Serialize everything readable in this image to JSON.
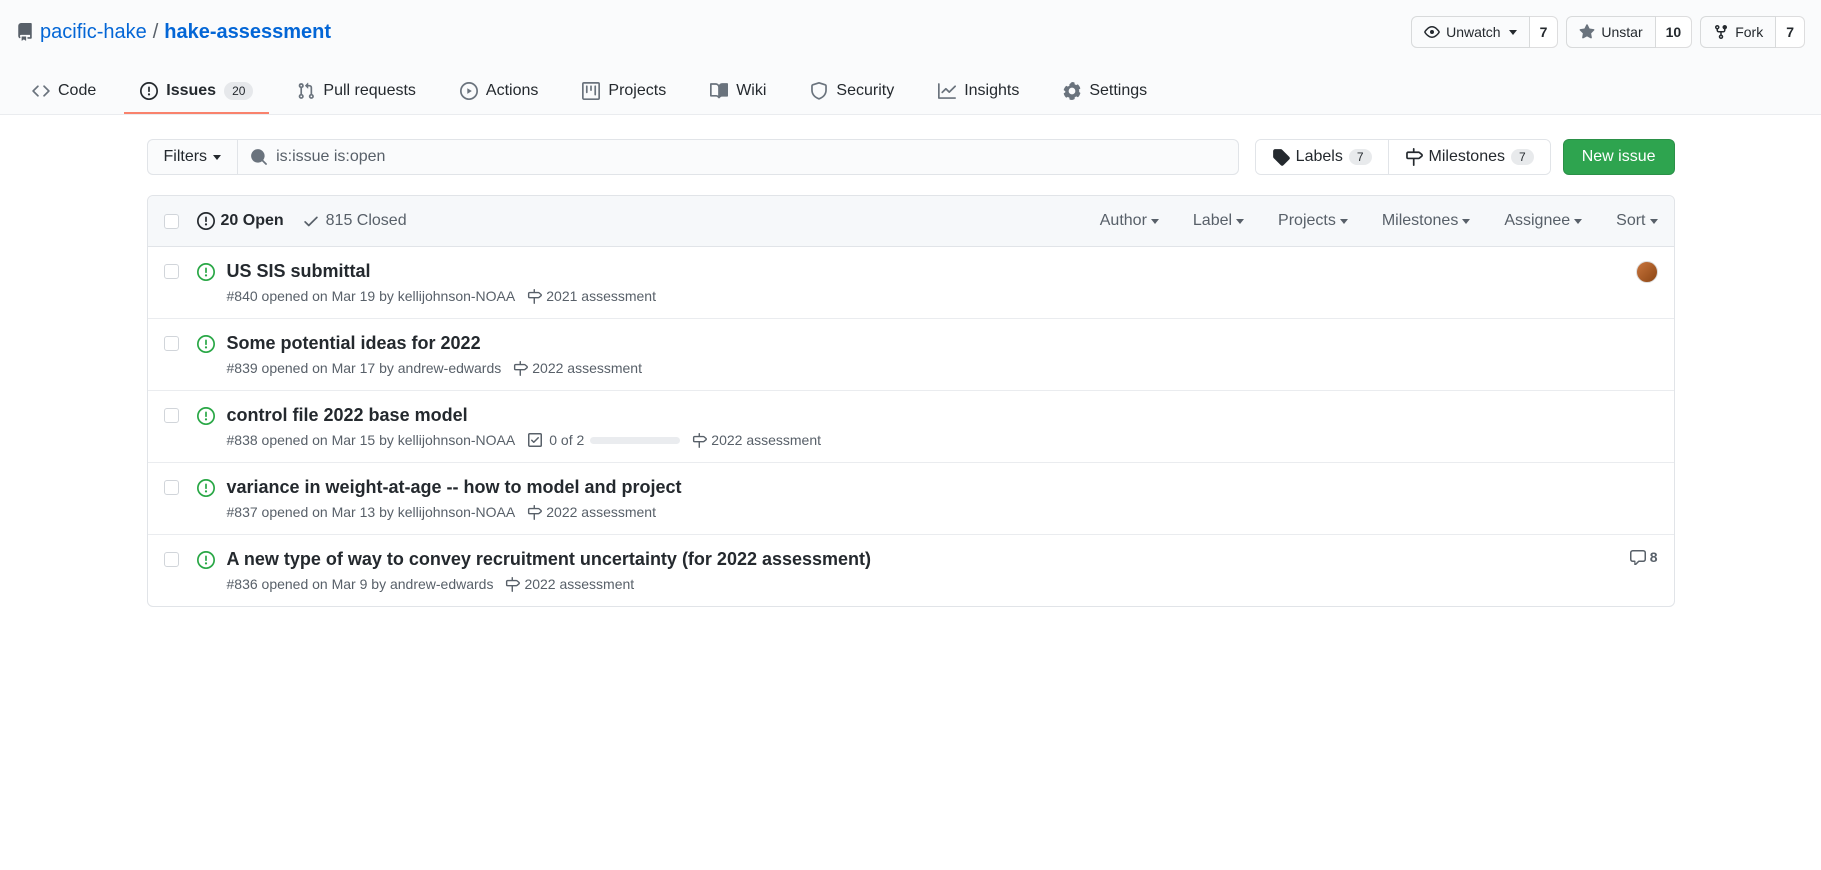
{
  "repo": {
    "owner": "pacific-hake",
    "name": "hake-assessment"
  },
  "actions": {
    "watch": {
      "label": "Unwatch",
      "count": "7"
    },
    "star": {
      "label": "Unstar",
      "count": "10"
    },
    "fork": {
      "label": "Fork",
      "count": "7"
    }
  },
  "nav": {
    "code": "Code",
    "issues": "Issues",
    "issues_count": "20",
    "pulls": "Pull requests",
    "actions": "Actions",
    "projects": "Projects",
    "wiki": "Wiki",
    "security": "Security",
    "insights": "Insights",
    "settings": "Settings"
  },
  "filters": {
    "button": "Filters",
    "search_value": "is:issue is:open",
    "labels": "Labels",
    "labels_count": "7",
    "milestones": "Milestones",
    "milestones_count": "7",
    "new_issue": "New issue"
  },
  "list_header": {
    "open": "20 Open",
    "closed": "815 Closed",
    "author": "Author",
    "label": "Label",
    "projects": "Projects",
    "milestones": "Milestones",
    "assignee": "Assignee",
    "sort": "Sort"
  },
  "issues": [
    {
      "title": "US SIS submittal",
      "meta": "#840 opened on Mar 19 by kellijohnson-NOAA",
      "milestone": "2021 assessment",
      "has_assignee": true
    },
    {
      "title": "Some potential ideas for 2022",
      "meta": "#839 opened on Mar 17 by andrew-edwards",
      "milestone": "2022 assessment"
    },
    {
      "title": "control file 2022 base model",
      "meta": "#838 opened on Mar 15 by kellijohnson-NOAA",
      "milestone": "2022 assessment",
      "tasks": "0 of 2"
    },
    {
      "title": "variance in weight-at-age -- how to model and project",
      "meta": "#837 opened on Mar 13 by kellijohnson-NOAA",
      "milestone": "2022 assessment"
    },
    {
      "title": "A new type of way to convey recruitment uncertainty (for 2022 assessment)",
      "meta": "#836 opened on Mar 9 by andrew-edwards",
      "milestone": "2022 assessment",
      "comments": "8"
    }
  ]
}
